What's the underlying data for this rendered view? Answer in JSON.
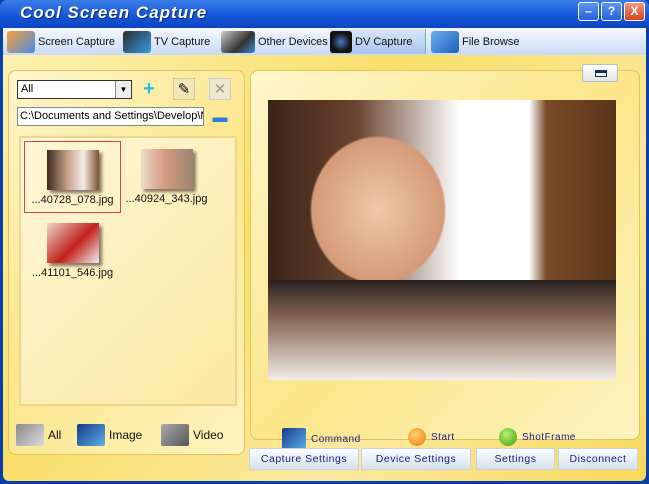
{
  "window": {
    "title": "Cool Screen Capture",
    "min": "–",
    "help": "?",
    "close": "X"
  },
  "tabs": [
    {
      "label": "Screen Capture"
    },
    {
      "label": "TV Capture"
    },
    {
      "label": "Other Devices"
    },
    {
      "label": "DV Capture"
    },
    {
      "label": "File Browse"
    }
  ],
  "left": {
    "filter_value": "All",
    "path_value": "C:\\Documents and Settings\\Develop\\M",
    "files": [
      {
        "name": "...40728_078.jpg"
      },
      {
        "name": "...40924_343.jpg"
      },
      {
        "name": "...41101_546.jpg"
      }
    ],
    "filters": [
      {
        "label": "All"
      },
      {
        "label": "Image"
      },
      {
        "label": "Video"
      }
    ]
  },
  "controls": {
    "command": "Command",
    "start": "Start",
    "shotframe": "ShotFrame"
  },
  "buttons": {
    "capture_settings": "Capture Settings",
    "device_settings": "Device Settings",
    "settings": "Settings",
    "disconnect": "Disconnect"
  }
}
